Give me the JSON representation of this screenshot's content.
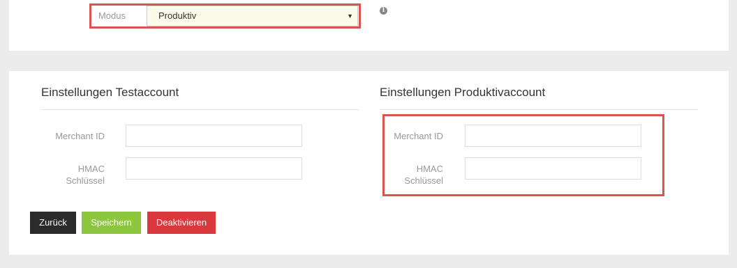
{
  "mode": {
    "label": "Modus",
    "selected": "Produktiv",
    "caret": "▼",
    "info_icon": "i"
  },
  "test_account": {
    "title": "Einstellungen Testaccount",
    "merchant_label": "Merchant ID",
    "hmac_label_line1": "HMAC",
    "hmac_label_line2": "Schlüssel",
    "merchant_value": "",
    "hmac_value": ""
  },
  "prod_account": {
    "title": "Einstellungen Produktivaccount",
    "merchant_label": "Merchant ID",
    "hmac_label_line1": "HMAC",
    "hmac_label_line2": "Schlüssel",
    "merchant_value": "",
    "hmac_value": ""
  },
  "buttons": {
    "back": "Zurück",
    "save": "Speichern",
    "deactivate": "Deaktivieren"
  },
  "colors": {
    "highlight": "#d9534f",
    "save": "#8cc63f",
    "deactivate": "#d9393c",
    "back": "#2b2b2b"
  }
}
